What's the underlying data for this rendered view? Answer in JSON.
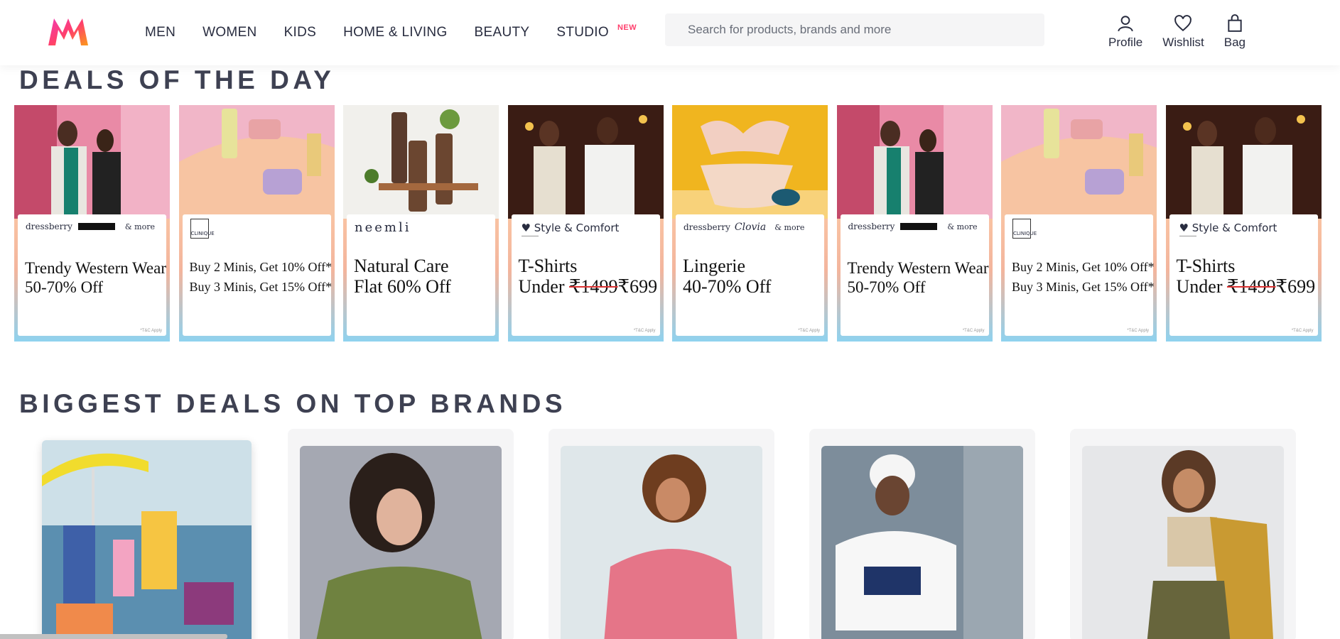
{
  "header": {
    "logo_name": "myntra-logo",
    "nav": [
      "MEN",
      "WOMEN",
      "KIDS",
      "HOME & LIVING",
      "BEAUTY",
      "STUDIO"
    ],
    "studio_badge": "NEW",
    "search_placeholder": "Search for products, brands and more",
    "actions": [
      "Profile",
      "Wishlist",
      "Bag"
    ],
    "accent_color": "#ff3f6c"
  },
  "sections": {
    "deals_title": "DEALS OF THE DAY",
    "brands_title": "BIGGEST DEALS ON TOP BRANDS"
  },
  "deals": [
    {
      "brand": "dressberry",
      "extra": "& more",
      "line1": "Trendy Western Wear",
      "line2": "50-70% Off",
      "tnc": "*T&C Apply"
    },
    {
      "brand": "CLINIQUE",
      "line1": "Buy 2 Minis, Get 10% Off*",
      "line2": "Buy 3 Minis, Get 15% Off*"
    },
    {
      "brand": "neemli",
      "line1": "Natural Care",
      "line2": "Flat 60% Off"
    },
    {
      "brand": "Style & Comfort",
      "line1": "T-Shirts",
      "line2_prefix": "Under ",
      "strike": "₹1499",
      "price": "₹699",
      "tnc": "*T&C Apply"
    },
    {
      "brand": "dressberry",
      "brand2": "Clovia",
      "extra": "& more",
      "line1": "Lingerie",
      "line2": "40-70% Off",
      "tnc": "*T&C Apply"
    },
    {
      "brand": "dressberry",
      "extra": "& more",
      "line1": "Trendy Western Wear",
      "line2": "50-70% Off",
      "tnc": "*T&C Apply"
    },
    {
      "brand": "CLINIQUE",
      "line1": "Buy 2 Minis, Get 10% Off*",
      "line2": "Buy 3 Minis, Get 15% Off*",
      "tnc": "*T&C Apply"
    },
    {
      "brand": "Style & Comfort",
      "line1": "T-Shirts",
      "line2_prefix": "Under ",
      "strike": "₹1499",
      "price": "₹699",
      "tnc": "*T&C Apply"
    }
  ]
}
